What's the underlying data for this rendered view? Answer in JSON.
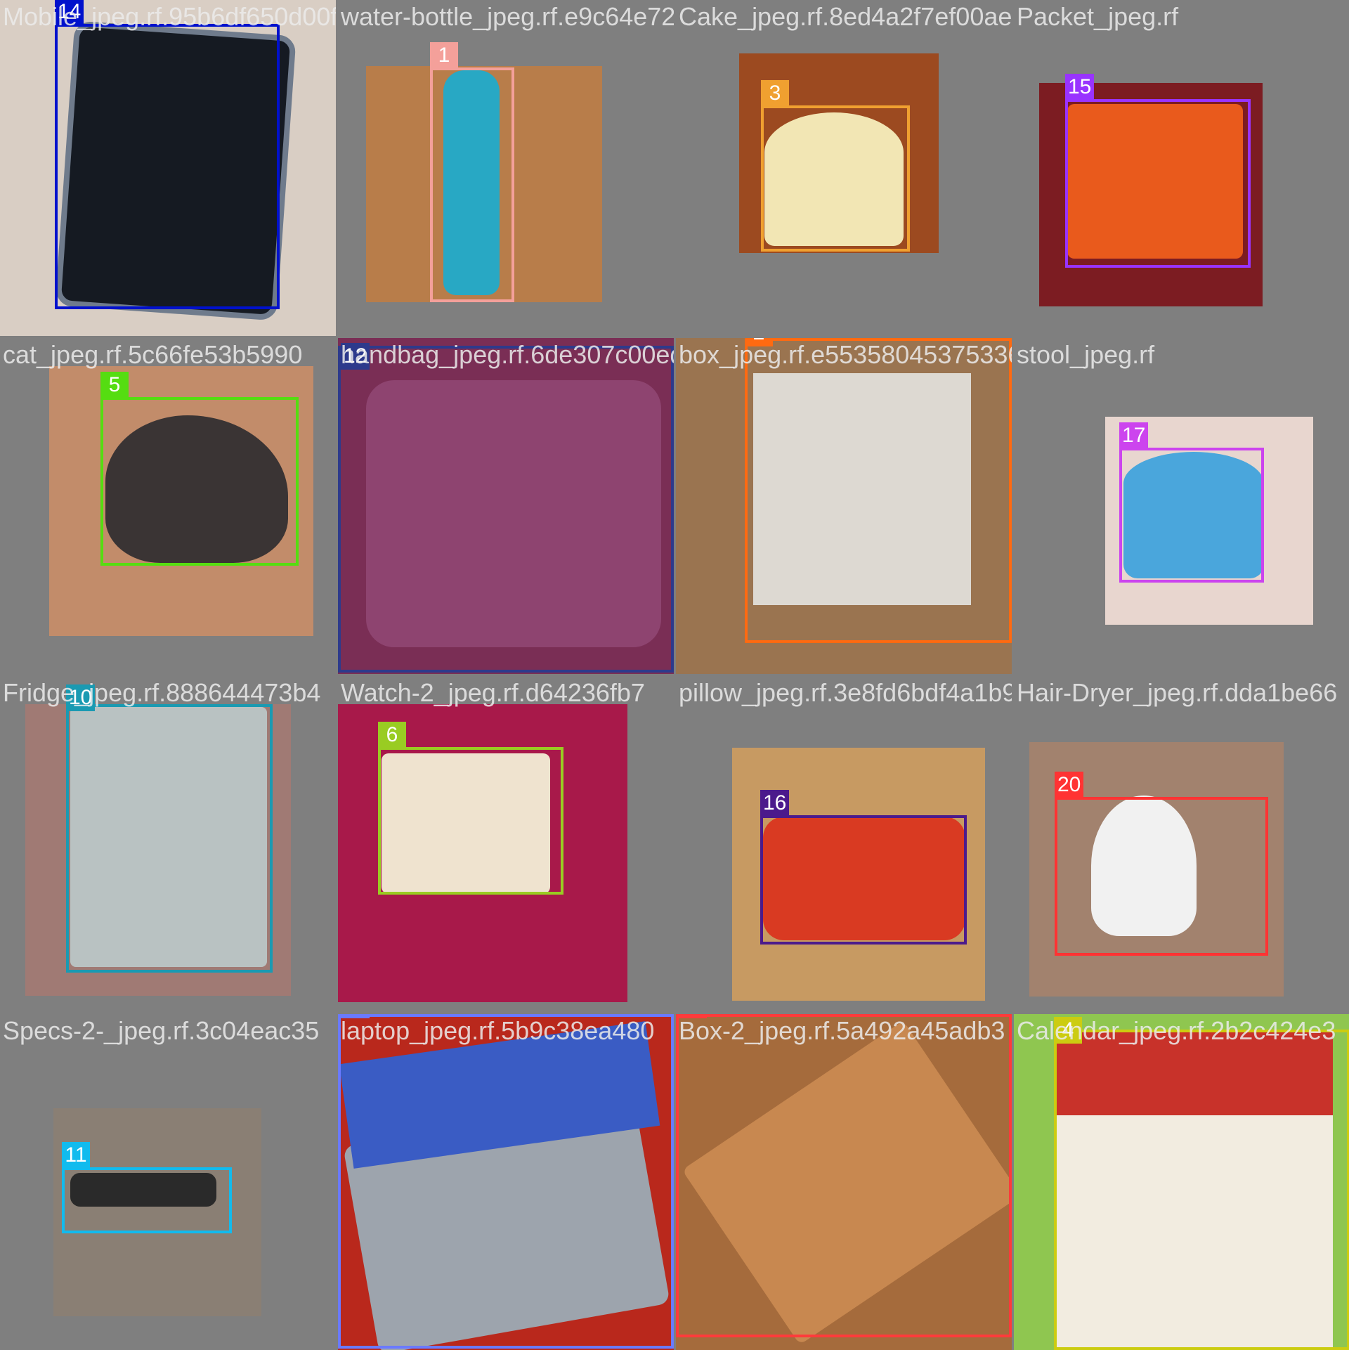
{
  "tiles": [
    {
      "filename": "Mobile_jpeg.rf.95b6df650d00fff318cb8a5ba3",
      "label": "14",
      "color": "#0011cc",
      "bg": "#d9cec4",
      "obj": "#151a22"
    },
    {
      "filename": "water-bottle_jpeg.rf.e9c64e72b68adf4f05c3ce141d94",
      "label": "1",
      "color": "#f4a09a",
      "bg": "#b87d4a",
      "obj": "#28a8c4"
    },
    {
      "filename": "Cake_jpeg.rf.8ed4a2f7ef00ae3cb",
      "label": "3",
      "color": "#f0a030",
      "bg": "#9c4a20",
      "obj": "#f2e6b4"
    },
    {
      "filename": "Packet_jpeg.rf",
      "label": "15",
      "color": "#9933ff",
      "bg": "#7c1c22",
      "obj": "#e95a1c"
    },
    {
      "filename": "cat_jpeg.rf.5c66fe53b5990",
      "label": "5",
      "color": "#55dd11",
      "bg": "#c28c6a",
      "obj": "#3a3434"
    },
    {
      "filename": "handbag_jpeg.rf.6de307c00edb784ba87f0",
      "label": "12",
      "color": "#2d3a8c",
      "bg": "#7a2e55",
      "obj": "#8e4470"
    },
    {
      "filename": "box_jpeg.rf.e553580453753364ee7387a2f28175266c3b4a",
      "label": "2",
      "color": "#ff6a11",
      "bg": "#9a7450",
      "obj": "#ddd9d2"
    },
    {
      "filename": "stool_jpeg.rf",
      "label": "17",
      "color": "#cc44ee",
      "bg": "#e8d6cf",
      "obj": "#4aa6dc"
    },
    {
      "filename": "Fridge_jpeg.rf.888644473b4",
      "label": "10",
      "color": "#1a9ab2",
      "bg": "#a07a74",
      "obj": "#b9c2c2"
    },
    {
      "filename": "Watch-2_jpeg.rf.d64236fb7",
      "label": "6",
      "color": "#99cc22",
      "bg": "#a8194a",
      "obj": "#efe3cf"
    },
    {
      "filename": "pillow_jpeg.rf.3e8fd6bdf4a1b9",
      "label": "16",
      "color": "#4b1a8c",
      "bg": "#c79a62",
      "obj": "#d93a22"
    },
    {
      "filename": "Hair-Dryer_jpeg.rf.dda1be66",
      "label": "20",
      "color": "#ff3333",
      "bg": "#a2826e",
      "obj": "#f1f1f1"
    },
    {
      "filename": "Specs-2-_jpeg.rf.3c04eac35",
      "label": "11",
      "color": "#11bbee",
      "bg": "#8a7f74",
      "obj": "#2a2a2a"
    },
    {
      "filename": "laptop_jpeg.rf.5b9c38ea480",
      "label": "13",
      "color": "#6a7aff",
      "bg": "#b9281c",
      "obj": "#9da4ad"
    },
    {
      "filename": "Box-2_jpeg.rf.5a492a45adb3",
      "label": "0",
      "color": "#ff3b3b",
      "bg": "#a56b3c",
      "obj": "#c88850"
    },
    {
      "filename": "Calendar_jpeg.rf.2b2c424e3",
      "label": "4",
      "color": "#cccc11",
      "bg": "#f2ece0",
      "obj": "#c8322a"
    }
  ]
}
